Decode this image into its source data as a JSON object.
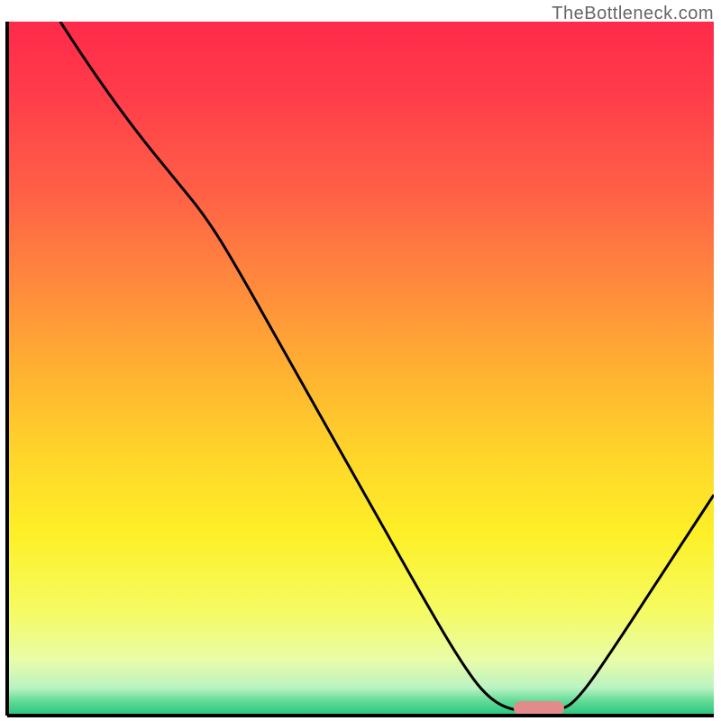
{
  "watermark": "TheBottleneck.com",
  "chart_data": {
    "type": "line",
    "title": "",
    "xlabel": "",
    "ylabel": "",
    "xlim": [
      0,
      1
    ],
    "ylim": [
      0,
      1
    ],
    "background": {
      "type": "vertical_gradient",
      "stops": [
        {
          "pos": 0.0,
          "color": "#ff2a4a"
        },
        {
          "pos": 0.1,
          "color": "#ff3b4a"
        },
        {
          "pos": 0.25,
          "color": "#ff6146"
        },
        {
          "pos": 0.38,
          "color": "#ff8a3d"
        },
        {
          "pos": 0.5,
          "color": "#ffb032"
        },
        {
          "pos": 0.62,
          "color": "#ffd42a"
        },
        {
          "pos": 0.74,
          "color": "#fdf028"
        },
        {
          "pos": 0.85,
          "color": "#f5fb62"
        },
        {
          "pos": 0.92,
          "color": "#e9fca8"
        },
        {
          "pos": 0.96,
          "color": "#baf3c2"
        },
        {
          "pos": 0.98,
          "color": "#5eda95"
        },
        {
          "pos": 1.0,
          "color": "#27c47c"
        }
      ]
    },
    "series": [
      {
        "name": "bottleneck-curve",
        "color": "#000000",
        "stroke_width": 3,
        "points": [
          {
            "x": 0.075,
            "y": 1.0
          },
          {
            "x": 0.12,
            "y": 0.93
          },
          {
            "x": 0.18,
            "y": 0.845
          },
          {
            "x": 0.24,
            "y": 0.77
          },
          {
            "x": 0.28,
            "y": 0.72
          },
          {
            "x": 0.32,
            "y": 0.655
          },
          {
            "x": 0.4,
            "y": 0.51
          },
          {
            "x": 0.5,
            "y": 0.33
          },
          {
            "x": 0.58,
            "y": 0.185
          },
          {
            "x": 0.64,
            "y": 0.08
          },
          {
            "x": 0.68,
            "y": 0.025
          },
          {
            "x": 0.72,
            "y": 0.005
          },
          {
            "x": 0.78,
            "y": 0.005
          },
          {
            "x": 0.81,
            "y": 0.025
          },
          {
            "x": 0.87,
            "y": 0.115
          },
          {
            "x": 0.94,
            "y": 0.225
          },
          {
            "x": 1.0,
            "y": 0.318
          }
        ]
      }
    ],
    "annotations": [
      {
        "type": "pill-marker",
        "x": 0.752,
        "y": 0.01,
        "color": "#e38a8a"
      }
    ]
  }
}
